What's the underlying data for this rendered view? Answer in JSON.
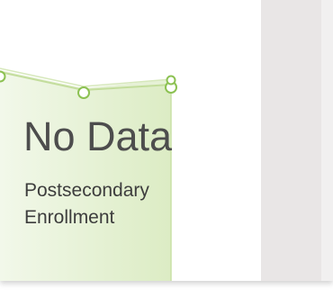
{
  "widget": {
    "value": "No Data",
    "label": "Postsecondary Enrollment"
  },
  "colors": {
    "fill_light": "#eef5e3",
    "fill_dark": "#d9eabf",
    "stroke": "#b5d58a",
    "marker": "#8cc152",
    "text": "#4d4d4d",
    "panel": "#e9e6e6"
  }
}
